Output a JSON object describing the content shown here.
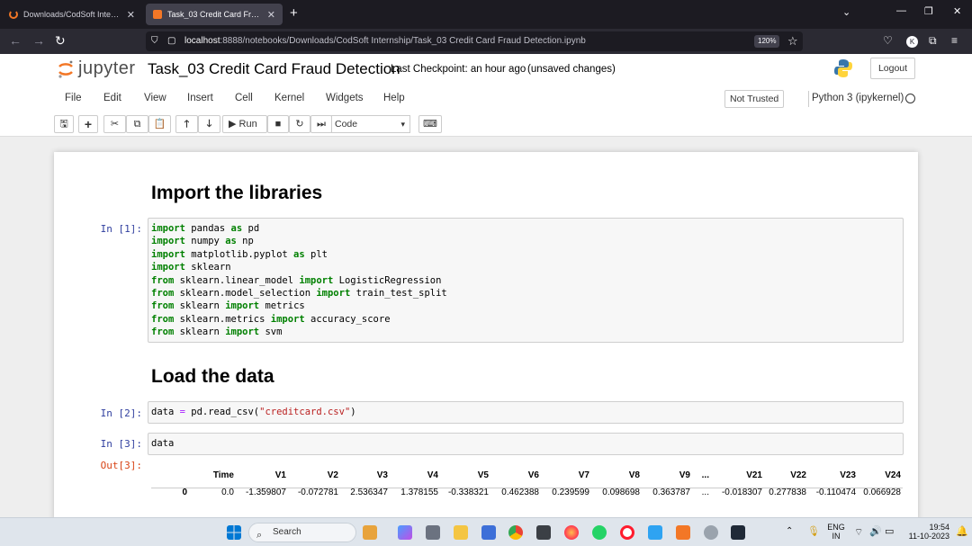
{
  "browser": {
    "tabs": [
      {
        "title": "Downloads/CodSoft Internship/",
        "active": false
      },
      {
        "title": "Task_03 Credit Card Fraud Detec",
        "active": true
      }
    ],
    "new_tab": "+",
    "url_host": "localhost",
    "url_rest": ":8888/notebooks/Downloads/CodSoft Internship/Task_03 Credit Card Fraud Detection.ipynb",
    "zoom": "120%"
  },
  "jupyter": {
    "logo_text": "jupyter",
    "notebook_title": "Task_03 Credit Card Fraud Detection",
    "checkpoint": "Last Checkpoint: an hour ago",
    "unsaved": "(unsaved changes)",
    "logout_label": "Logout",
    "menus": [
      "File",
      "Edit",
      "View",
      "Insert",
      "Cell",
      "Kernel",
      "Widgets",
      "Help"
    ],
    "trust_status": "Not Trusted",
    "kernel_name": "Python 3 (ipykernel)",
    "run_label": "Run",
    "cell_type": "Code"
  },
  "cells": {
    "heading1": "Import the libraries",
    "prompt1": "In [1]:",
    "heading2": "Load the data",
    "prompt2": "In [2]:",
    "prompt3": "In [3]:",
    "prompt3_out": "Out[3]:",
    "cell3_code": "data"
  },
  "dataframe": {
    "columns": [
      "Time",
      "V1",
      "V2",
      "V3",
      "V4",
      "V5",
      "V6",
      "V7",
      "V8",
      "V9",
      "...",
      "V21",
      "V22",
      "V23",
      "V24"
    ],
    "row0": [
      "0",
      "0.0",
      "-1.359807",
      "-0.072781",
      "2.536347",
      "1.378155",
      "-0.338321",
      "0.462388",
      "0.239599",
      "0.098698",
      "0.363787",
      "...",
      "-0.018307",
      "0.277838",
      "-0.110474",
      "0.066928"
    ]
  },
  "taskbar": {
    "search": "Search",
    "lang_top": "ENG",
    "lang_bottom": "IN",
    "time": "19:54",
    "date": "11-10-2023"
  }
}
